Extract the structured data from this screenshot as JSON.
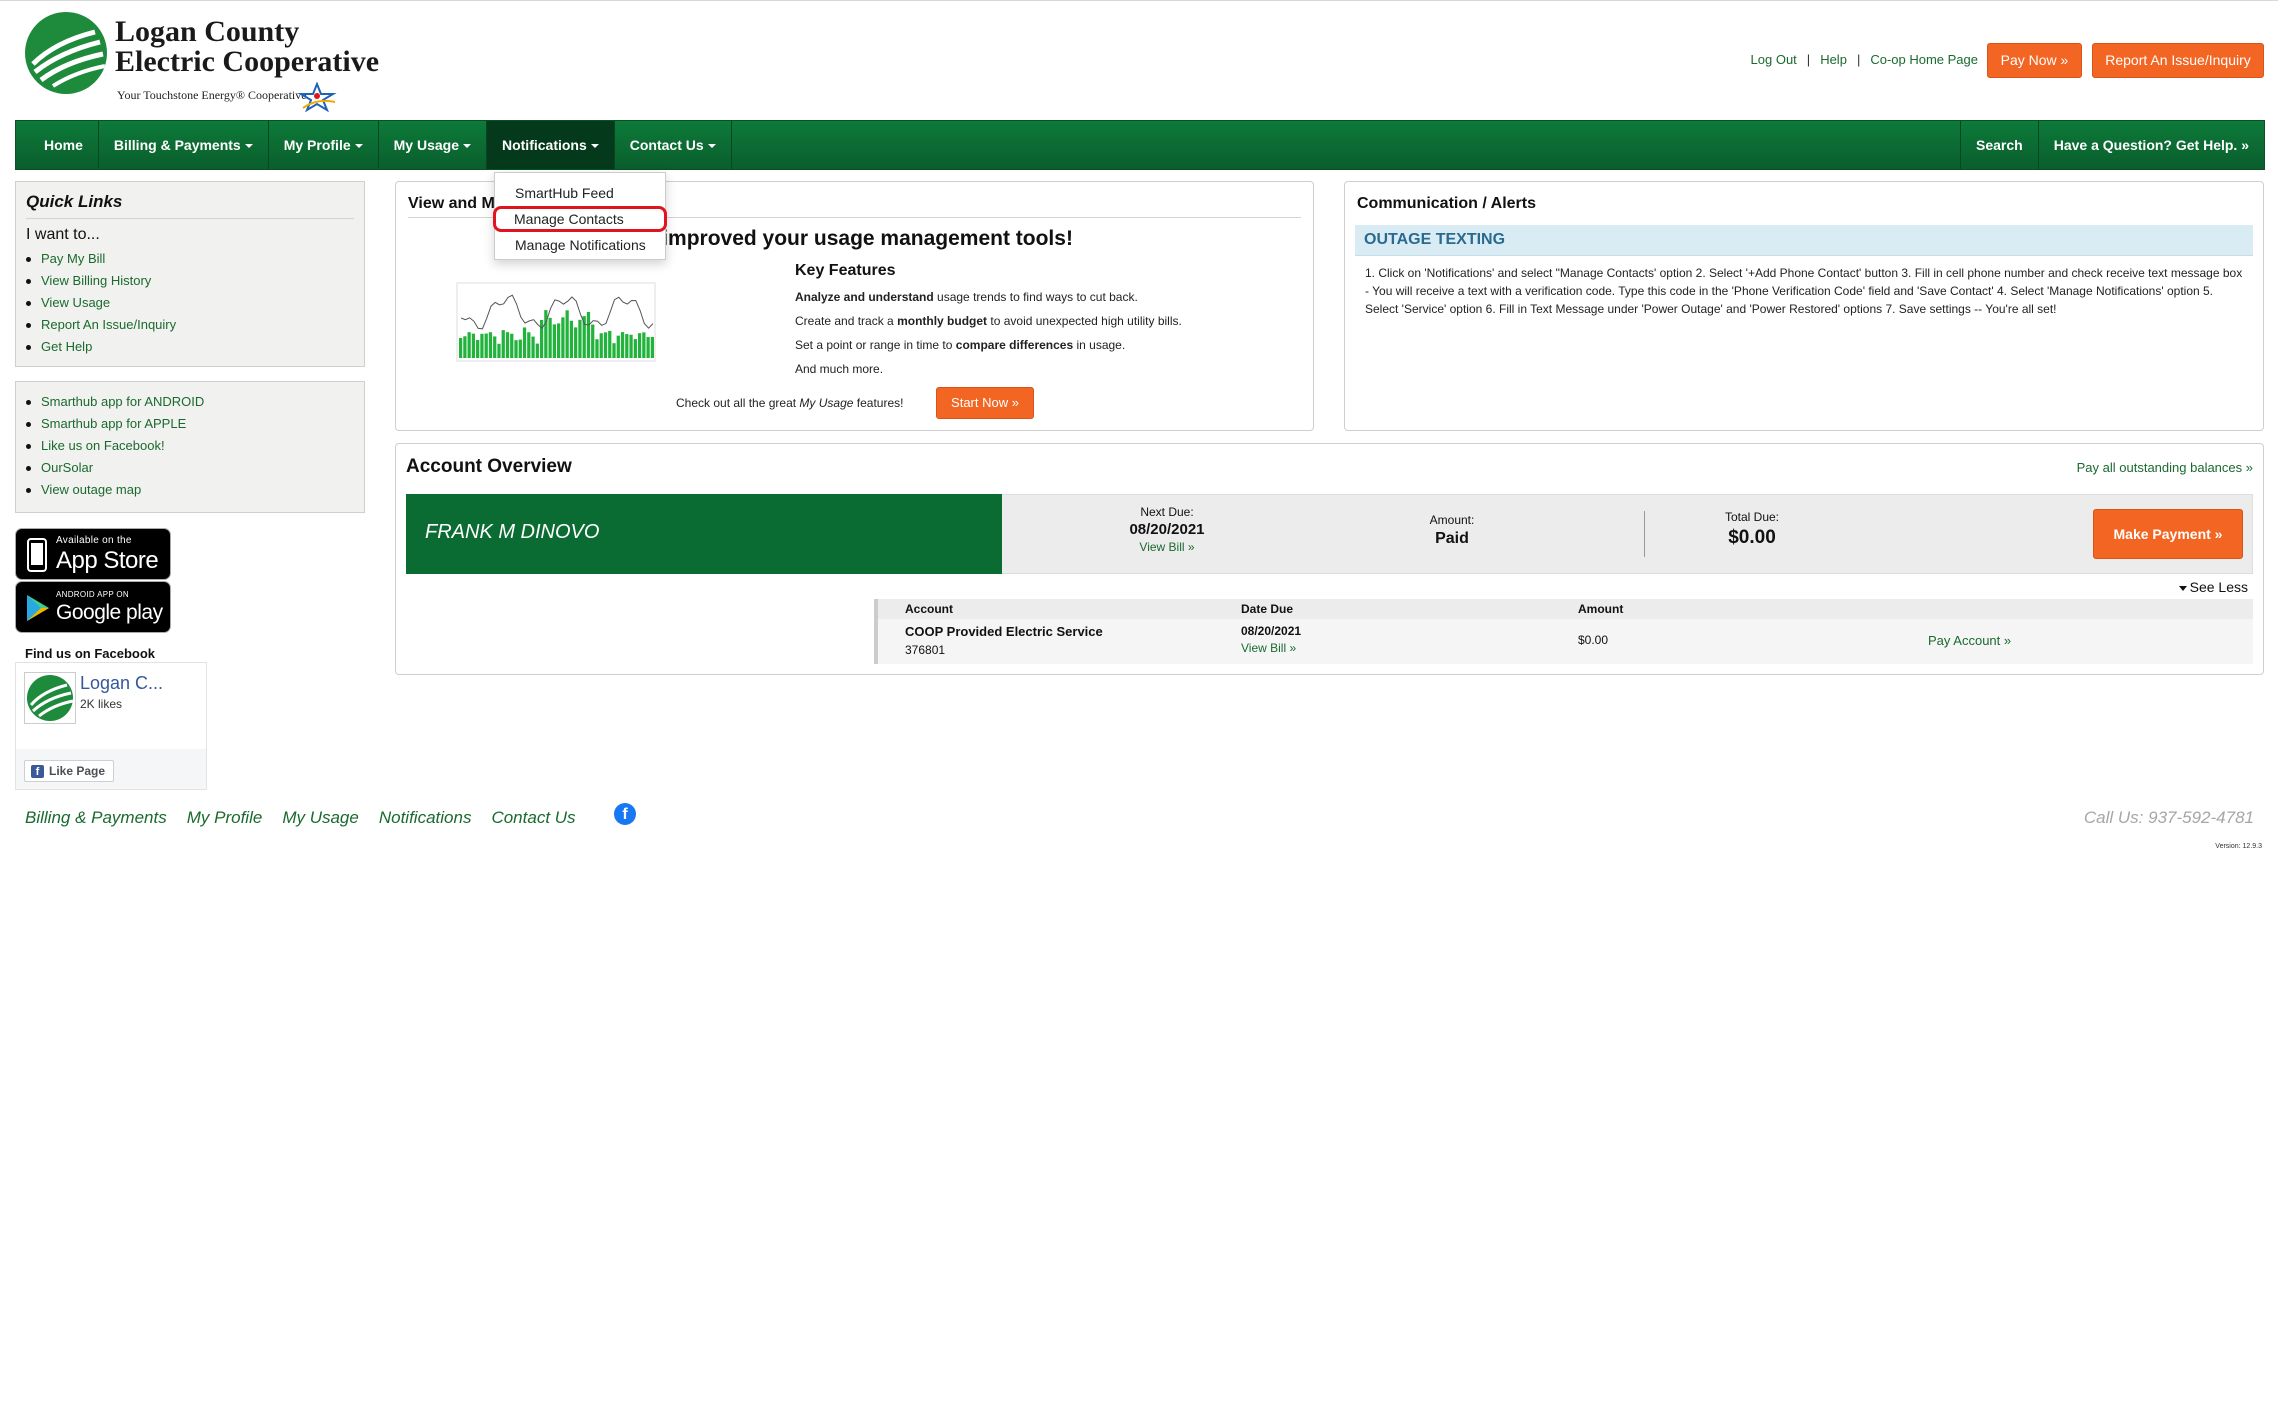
{
  "header": {
    "logo_name_line1": "Logan County",
    "logo_name_line2": "Electric Cooperative",
    "logo_tagline": "Your Touchstone Energy® Cooperative",
    "top_links": [
      "Log Out",
      "Help",
      "Co-op Home Page"
    ],
    "pay_now": "Pay Now »",
    "report_issue": "Report An Issue/Inquiry"
  },
  "nav": {
    "items": [
      "Home",
      "Billing & Payments",
      "My Profile",
      "My Usage",
      "Notifications",
      "Contact Us"
    ],
    "right_items": [
      "Search",
      "Have a Question? Get Help. »"
    ],
    "dropdown": [
      "SmartHub Feed",
      "Manage Contacts",
      "Manage Notifications"
    ]
  },
  "quick_links": {
    "title": "Quick Links",
    "want": "I want to...",
    "items": [
      "Pay My Bill",
      "View Billing History",
      "View Usage",
      "Report An Issue/Inquiry",
      "Get Help"
    ]
  },
  "app_links": [
    "Smarthub app for ANDROID",
    "Smarthub app for APPLE",
    "Like us on Facebook!",
    "OurSolar",
    "View outage map"
  ],
  "badges": {
    "appstore_small": "Available on the",
    "appstore_big": "App Store",
    "play_small": "ANDROID APP ON",
    "play_big": "Google play"
  },
  "facebook": {
    "find": "Find us on Facebook",
    "page_name": "Logan C...",
    "likes": "2K likes",
    "like_btn": "Like Page"
  },
  "usage_panel": {
    "title": "View and M",
    "headline": "ve improved your usage management tools!",
    "key_features": "Key Features",
    "features": [
      {
        "bold": "Analyze and understand",
        "rest": " usage trends to find ways to cut back."
      },
      {
        "pre": "Create and track a ",
        "bold": "monthly budget",
        "rest": " to avoid unexpected high utility bills."
      },
      {
        "pre": "Set a point or range in time to ",
        "bold": "compare differences",
        "rest": " in usage."
      },
      {
        "pre": "And much more.",
        "bold": "",
        "rest": ""
      }
    ],
    "checkout_pre": "Check out all the great ",
    "checkout_em": "My Usage",
    "checkout_post": " features!",
    "start_now": "Start Now »"
  },
  "comm_panel": {
    "title": "Communication / Alerts",
    "outage_title": "OUTAGE TEXTING",
    "outage_text": "1. Click on 'Notifications' and select \"Manage Contacts' option 2. Select '+Add Phone Contact' button 3. Fill in cell phone number and check receive text message box - You will receive a text with a verification code. Type this code in the 'Phone Verification Code' field and 'Save Contact' 4. Select 'Manage Notifications' option 5. Select 'Service' option 6. Fill in Text Message under 'Power Outage' and 'Power Restored' options 7. Save settings -- You're all set!"
  },
  "account": {
    "title": "Account Overview",
    "pay_all": "Pay all outstanding balances »",
    "name": "FRANK M DINOVO",
    "next_due_label": "Next Due:",
    "next_due": "08/20/2021",
    "view_bill": "View Bill »",
    "amount_label": "Amount:",
    "amount": "Paid",
    "total_due_label": "Total Due:",
    "total_due": "$0.00",
    "make_payment": "Make Payment »",
    "see_less": "See Less",
    "table_headers": [
      "Account",
      "Date Due",
      "Amount"
    ],
    "row": {
      "service": "COOP Provided Electric Service",
      "number": "376801",
      "date_due": "08/20/2021",
      "view_bill": "View Bill »",
      "amount": "$0.00",
      "pay_account": "Pay Account »"
    }
  },
  "footer": {
    "links": [
      "Billing & Payments",
      "My Profile",
      "My Usage",
      "Notifications",
      "Contact Us"
    ],
    "call": "Call Us: 937-592-4781",
    "version": "Version: 12.9.3"
  },
  "colors": {
    "brand_green": "#0b6c33",
    "accent_orange": "#f26522",
    "highlight_red": "#e0141e"
  }
}
